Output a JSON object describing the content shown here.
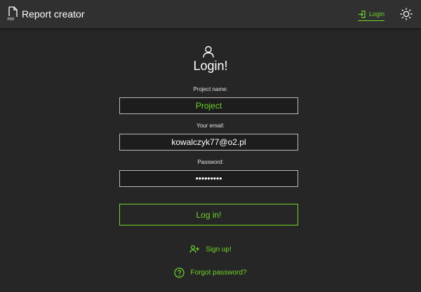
{
  "header": {
    "app_icon": "pdf-file-icon",
    "app_icon_text": "PDF",
    "title": "Report creator",
    "login_link": "Login",
    "login_icon": "login-icon",
    "theme_icon": "sun-icon"
  },
  "form": {
    "user_icon": "user-icon",
    "title": "Login!",
    "project_label": "Project name:",
    "project_placeholder": "Project",
    "project_value": "",
    "email_label": "Your email:",
    "email_value": "kowalczyk77@o2.pl",
    "password_label": "Password:",
    "password_value": "•••••••••",
    "submit_label": "Log in!"
  },
  "links": {
    "signup_icon": "add-user-icon",
    "signup_label": "Sign up!",
    "forgot_icon": "question-icon",
    "forgot_label": "Forgot password?"
  },
  "colors": {
    "background": "#262626",
    "header": "#303030",
    "accent": "#6fd52a",
    "text": "#ffffff",
    "input_border": "#b8b8b8"
  }
}
